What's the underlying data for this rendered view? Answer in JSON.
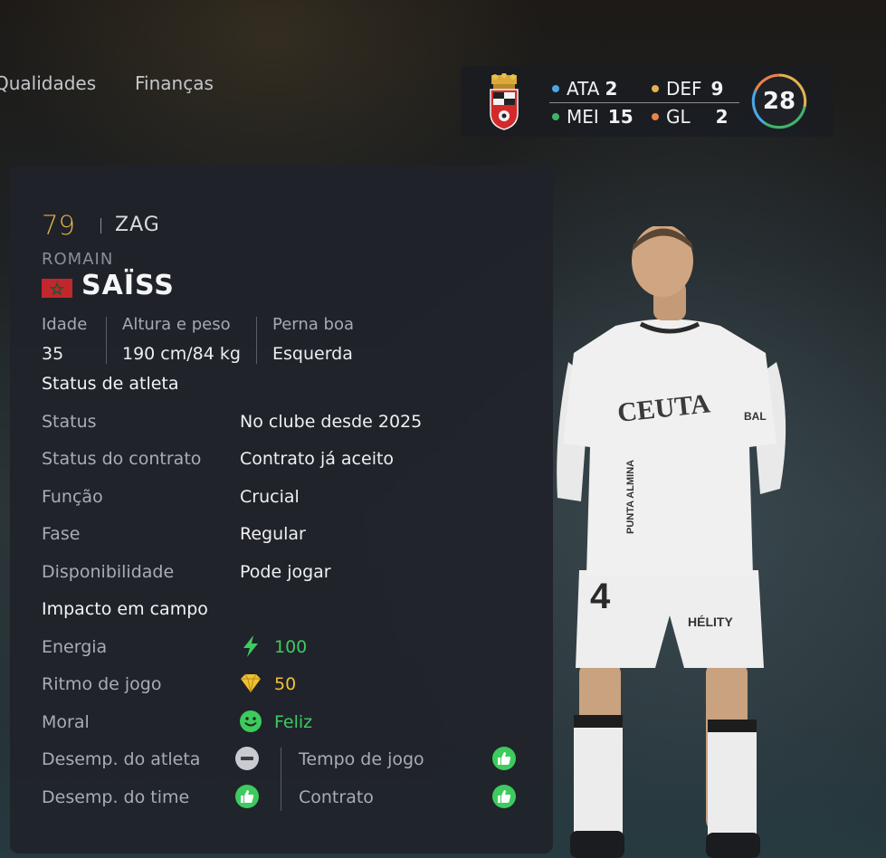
{
  "tabs": [
    {
      "label": "Qualidades"
    },
    {
      "label": "Finanças"
    }
  ],
  "team_summary": {
    "positions": [
      {
        "label": "ATA",
        "count": "2",
        "color": "#4aa6e8"
      },
      {
        "label": "DEF",
        "count": "9",
        "color": "#e3b24c"
      },
      {
        "label": "MEI",
        "count": "15",
        "color": "#3fb56b"
      },
      {
        "label": "GL",
        "count": "2",
        "color": "#e8834a"
      }
    ],
    "total": "28"
  },
  "player": {
    "rating": "79",
    "position": "ZAG",
    "first_name": "ROMAIN",
    "last_name": "SAÏSS",
    "flag": "morocco-flag"
  },
  "bio": {
    "age_label": "Idade",
    "age": "35",
    "height_weight_label": "Altura e peso",
    "height_weight": "190 cm/84 kg",
    "foot_label": "Perna boa",
    "foot": "Esquerda"
  },
  "status_section": {
    "title": "Status de atleta",
    "rows": [
      {
        "label": "Status",
        "value": "No clube desde 2025"
      },
      {
        "label": "Status do contrato",
        "value": "Contrato já aceito"
      },
      {
        "label": "Função",
        "value": "Crucial"
      },
      {
        "label": "Fase",
        "value": "Regular"
      },
      {
        "label": "Disponibilidade",
        "value": "Pode jogar"
      }
    ]
  },
  "impact_section": {
    "title": "Impacto em campo",
    "energy": {
      "label": "Energia",
      "value": "100",
      "icon": "lightning-icon"
    },
    "rhythm": {
      "label": "Ritmo de jogo",
      "value": "50",
      "icon": "diamond-icon"
    },
    "morale": {
      "label": "Moral",
      "value": "Feliz",
      "icon": "smiley-icon"
    },
    "player_perf": {
      "label": "Desemp. do atleta",
      "icon": "neutral-icon"
    },
    "team_perf": {
      "label": "Desemp. do time",
      "icon": "thumbs-up-icon"
    },
    "play_time": {
      "label": "Tempo de jogo",
      "icon": "thumbs-up-icon"
    },
    "contract": {
      "label": "Contrato",
      "icon": "thumbs-up-icon"
    }
  },
  "kit": {
    "sponsor": "CEUTA",
    "sleeve_sponsor": "PUNTA ALMINA",
    "shorts_number": "4",
    "shorts_sponsor": "HÉLITY",
    "sleeve_text": "BAL"
  }
}
